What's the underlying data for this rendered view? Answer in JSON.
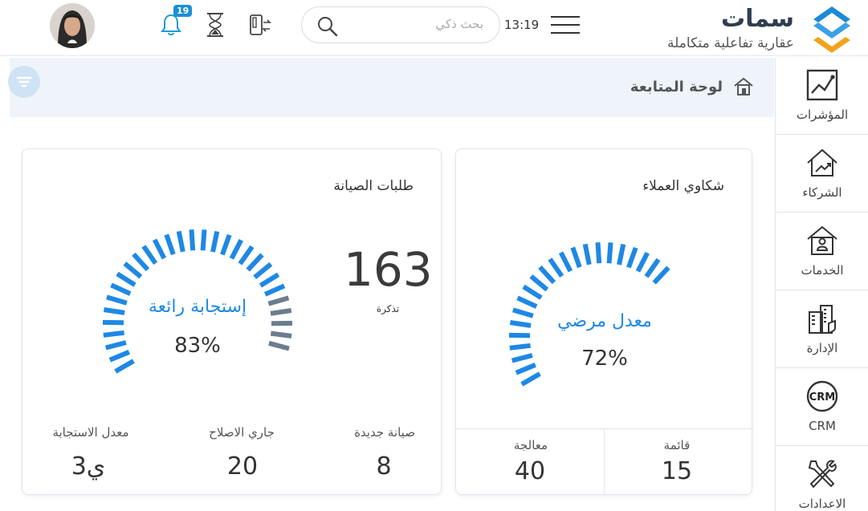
{
  "brand": {
    "name": "سمات",
    "tagline": "عقارية تفاعلية متكاملة"
  },
  "header": {
    "time": "13:19",
    "search_placeholder": "بحث ذكي",
    "notifications_count": "19"
  },
  "sidebar": {
    "items": [
      {
        "label": "المؤشرات",
        "icon": "chart-icon"
      },
      {
        "label": "الشركاء",
        "icon": "partners-house-icon"
      },
      {
        "label": "الخدمات",
        "icon": "services-house-icon"
      },
      {
        "label": "الإدارة",
        "icon": "buildings-icon"
      },
      {
        "label": "CRM",
        "icon": "crm-icon"
      },
      {
        "label": "الاعدادات",
        "icon": "tools-icon"
      }
    ]
  },
  "breadcrumb": {
    "title": "لوحة المتابعة"
  },
  "maintenance": {
    "title": "طلبات الصيانة",
    "tickets_count": "163",
    "tickets_label": "تذكرة",
    "gauge_label": "إستجابة رائعة",
    "gauge_value": "83%",
    "gauge_fraction": 0.83,
    "stats": [
      {
        "label": "صيانة جديدة",
        "value": "8"
      },
      {
        "label": "جاري الاصلاح",
        "value": "20"
      },
      {
        "label": "معدل الاستجابة",
        "value": "3ي"
      }
    ]
  },
  "complaints": {
    "title": "شكاوي العملاء",
    "gauge_label": "معدل مرضي",
    "gauge_value": "72%",
    "gauge_fraction": 0.72,
    "stats": [
      {
        "label": "قائمة",
        "value": "15"
      },
      {
        "label": "معالجة",
        "value": "40"
      }
    ]
  },
  "colors": {
    "accent": "#1e88e5",
    "accent_dark": "#1565c0",
    "gray_segment": "#6b7d8e",
    "crumb_bg": "#eef4fa"
  }
}
